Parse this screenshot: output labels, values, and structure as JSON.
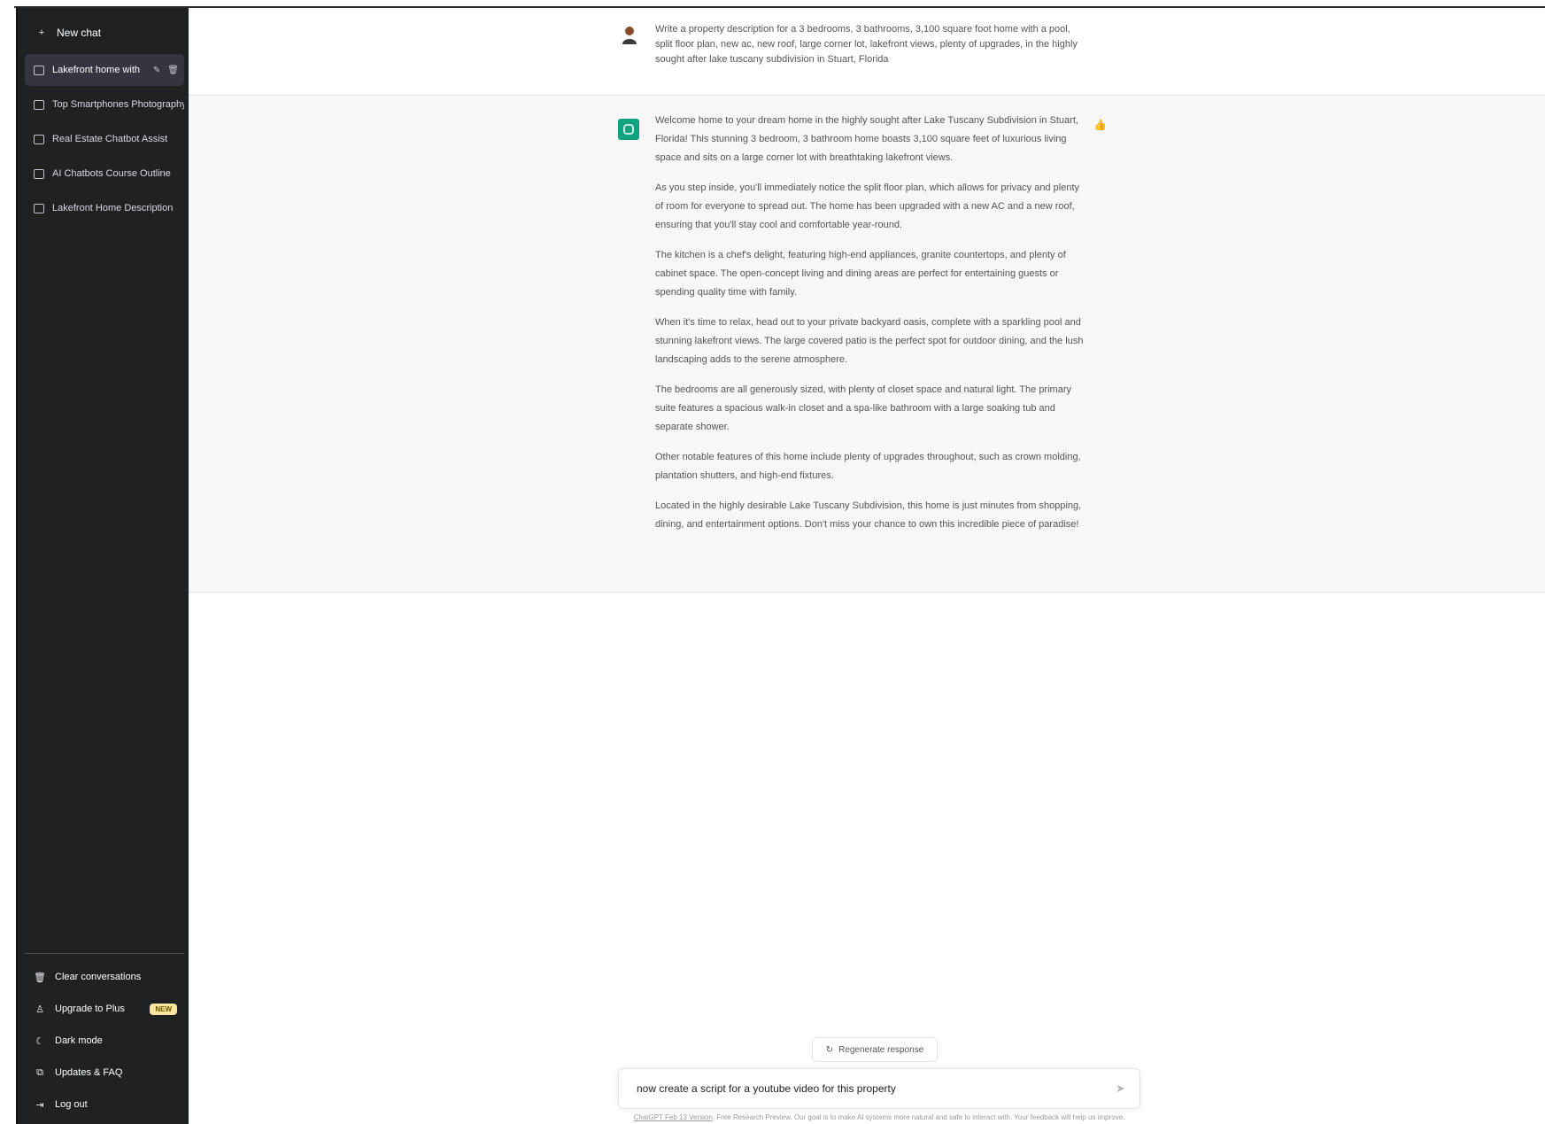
{
  "sidebar": {
    "new_chat_label": "New chat",
    "history": [
      {
        "label": "Lakefront home with",
        "active": true
      },
      {
        "label": "Top Smartphones Photography"
      },
      {
        "label": "Real Estate Chatbot Assist"
      },
      {
        "label": "AI Chatbots Course Outline"
      },
      {
        "label": "Lakefront Home Description"
      }
    ],
    "bottom": {
      "clear_label": "Clear conversations",
      "upgrade_label": "Upgrade to Plus",
      "upgrade_badge": "NEW",
      "dark_mode_label": "Dark mode",
      "updates_label": "Updates & FAQ",
      "logout_label": "Log out"
    }
  },
  "conversation": {
    "user_message": "Write a property description for a 3 bedrooms, 3 bathrooms, 3,100 square foot home with a pool, split floor plan, new ac, new roof, large corner lot, lakefront views, plenty of upgrades, in the highly sought after lake tuscany subdivision in Stuart, Florida",
    "assistant_paragraphs": [
      "Welcome home to your dream home in the highly sought after Lake Tuscany Subdivision in Stuart, Florida! This stunning 3 bedroom, 3 bathroom home boasts 3,100 square feet of luxurious living space and sits on a large corner lot with breathtaking lakefront views.",
      "As you step inside, you'll immediately notice the split floor plan, which allows for privacy and plenty of room for everyone to spread out. The home has been upgraded with a new AC and a new roof, ensuring that you'll stay cool and comfortable year-round.",
      "The kitchen is a chef's delight, featuring high-end appliances, granite countertops, and plenty of cabinet space. The open-concept living and dining areas are perfect for entertaining guests or spending quality time with family.",
      "When it's time to relax, head out to your private backyard oasis, complete with a sparkling pool and stunning lakefront views. The large covered patio is the perfect spot for outdoor dining, and the lush landscaping adds to the serene atmosphere.",
      "The bedrooms are all generously sized, with plenty of closet space and natural light. The primary suite features a spacious walk-in closet and a spa-like bathroom with a large soaking tub and separate shower.",
      "Other notable features of this home include plenty of upgrades throughout, such as crown molding, plantation shutters, and high-end fixtures.",
      "Located in the highly desirable Lake Tuscany Subdivision, this home is just minutes from shopping, dining, and entertainment options. Don't miss your chance to own this incredible piece of paradise!"
    ]
  },
  "composer": {
    "regenerate_label": "Regenerate response",
    "input_value": "now create a script for a youtube video for this property",
    "footer_link": "ChatGPT Feb 13 Version",
    "footer_text": ". Free Research Preview. Our goal is to make AI systems more natural and safe to interact with. Your feedback will help us improve."
  },
  "colors": {
    "sidebar_bg": "#202123",
    "accent_green": "#10a37f",
    "badge_bg": "#fae69e"
  }
}
